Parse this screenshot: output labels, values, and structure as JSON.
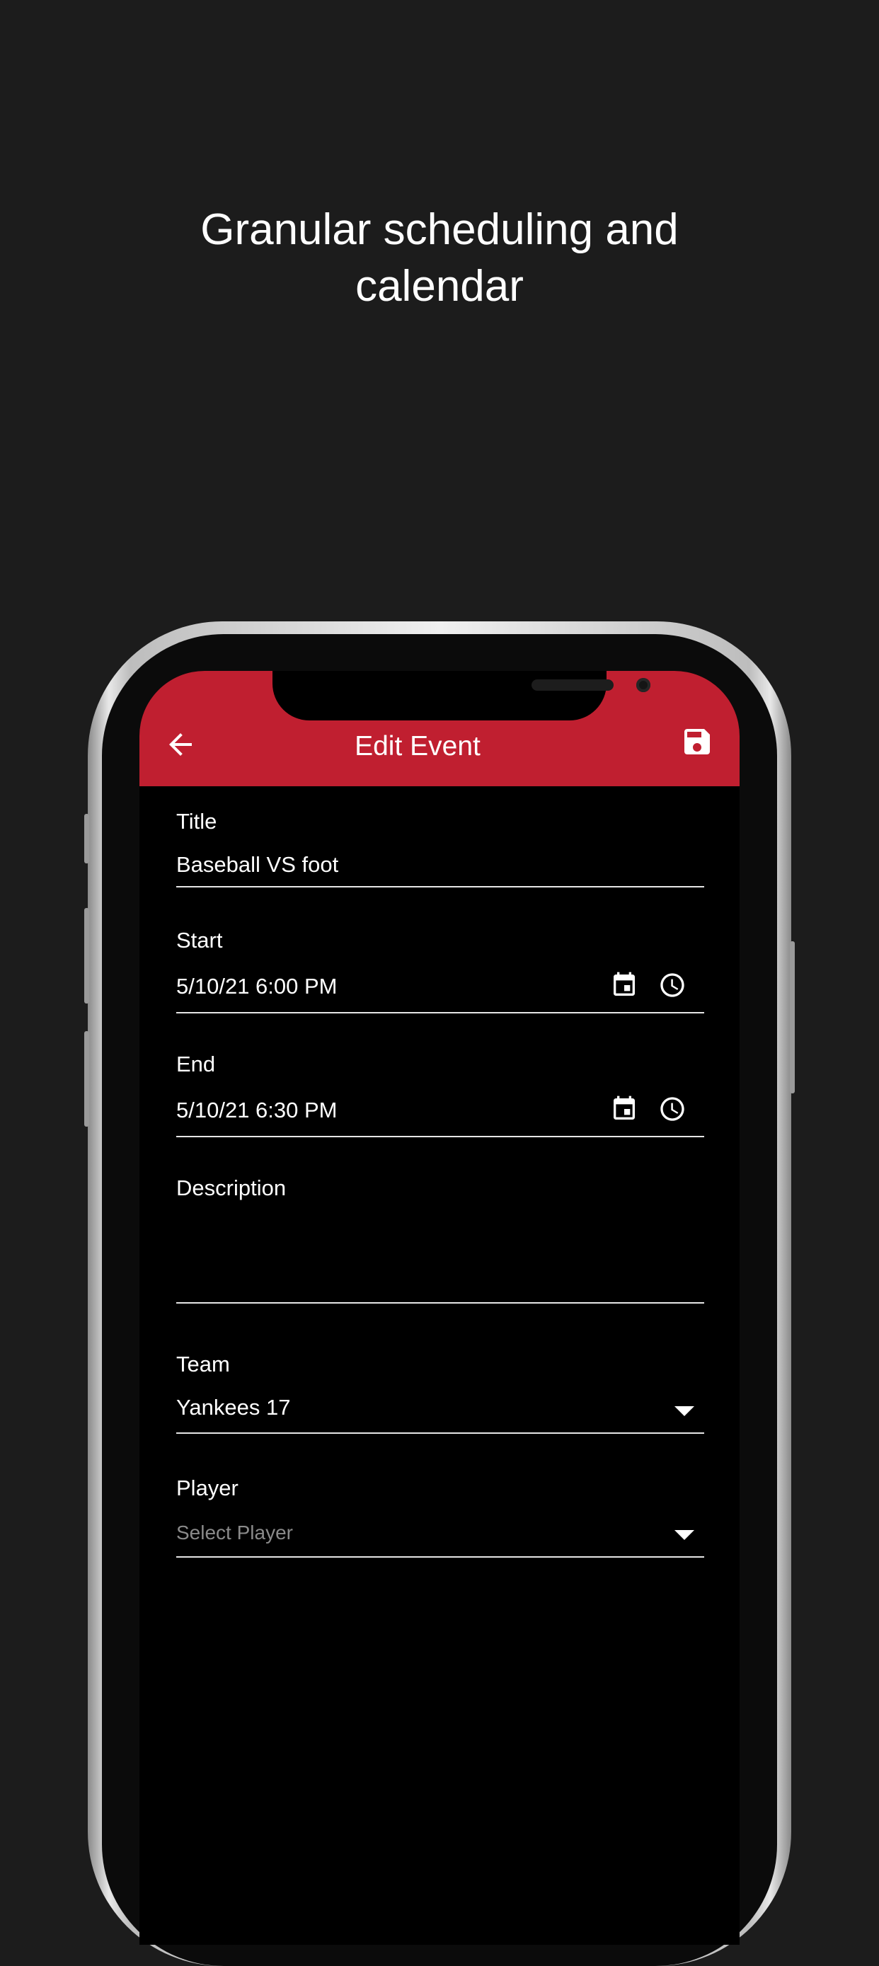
{
  "headline": {
    "line1": "Granular scheduling and",
    "line2": "calendar"
  },
  "app_bar": {
    "title": "Edit Event",
    "back_icon": "arrow-back-icon",
    "save_icon": "save-icon",
    "color": "#c01f30"
  },
  "form": {
    "title": {
      "label": "Title",
      "value": "Baseball VS foot"
    },
    "start": {
      "label": "Start",
      "value": "5/10/21 6:00 PM"
    },
    "end": {
      "label": "End",
      "value": "5/10/21 6:30 PM"
    },
    "description": {
      "label": "Description",
      "value": ""
    },
    "team": {
      "label": "Team",
      "value": "Yankees 17"
    },
    "player": {
      "label": "Player",
      "placeholder": "Select Player"
    }
  }
}
